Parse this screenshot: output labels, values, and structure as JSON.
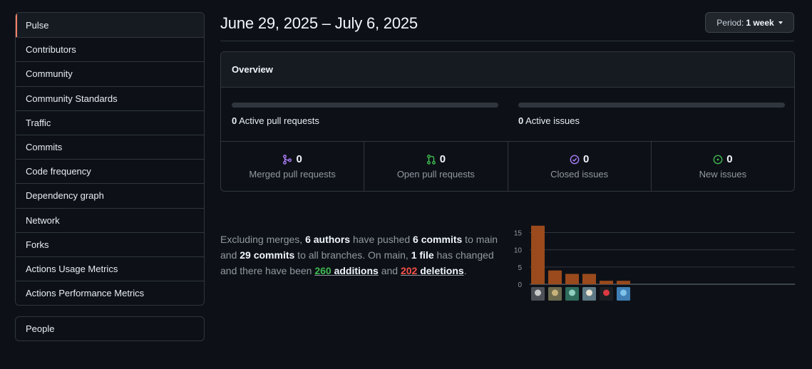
{
  "sidebar": {
    "items": [
      {
        "label": "Pulse"
      },
      {
        "label": "Contributors"
      },
      {
        "label": "Community"
      },
      {
        "label": "Community Standards"
      },
      {
        "label": "Traffic"
      },
      {
        "label": "Commits"
      },
      {
        "label": "Code frequency"
      },
      {
        "label": "Dependency graph"
      },
      {
        "label": "Network"
      },
      {
        "label": "Forks"
      },
      {
        "label": "Actions Usage Metrics"
      },
      {
        "label": "Actions Performance Metrics"
      }
    ],
    "people_label": "People"
  },
  "header": {
    "title": "June 29, 2025 – July 6, 2025",
    "period_prefix": "Period:",
    "period_value": "1 week"
  },
  "overview": {
    "title": "Overview",
    "active_prs_count": "0",
    "active_prs_label": "Active pull requests",
    "active_issues_count": "0",
    "active_issues_label": "Active issues",
    "stats": [
      {
        "icon": "git-merge-icon",
        "count": "0",
        "label": "Merged pull requests",
        "color": "#ab7df8"
      },
      {
        "icon": "git-pull-request-icon",
        "count": "0",
        "label": "Open pull requests",
        "color": "#3fb950"
      },
      {
        "icon": "issue-closed-icon",
        "count": "0",
        "label": "Closed issues",
        "color": "#ab7df8"
      },
      {
        "icon": "issue-opened-icon",
        "count": "0",
        "label": "New issues",
        "color": "#3fb950"
      }
    ]
  },
  "summary": {
    "t1": "Excluding merges, ",
    "authors": "6 authors",
    "t2": " have pushed ",
    "commits_main": "6 commits",
    "t3": " to main and ",
    "commits_all": "29 commits",
    "t4": " to all branches. On main, ",
    "files": "1 file",
    "t5": " has changed and there have been ",
    "additions_num": "260",
    "additions_word": "additions",
    "t6": " and ",
    "deletions_num": "202",
    "deletions_word": "deletions",
    "t7": "."
  },
  "colors": {
    "bar": "#9a4a1d",
    "accent_selected": "#f78166",
    "green": "#3fb950",
    "red": "#f85149",
    "purple": "#ab7df8"
  },
  "chart_data": {
    "type": "bar",
    "categories": [
      "author-1",
      "author-2",
      "author-3",
      "author-4",
      "author-5",
      "author-6"
    ],
    "values": [
      17,
      4,
      3,
      3,
      1,
      1
    ],
    "yticks": [
      "0",
      "5",
      "10",
      "15"
    ],
    "ylim": [
      0,
      18
    ],
    "grid": true,
    "xlabel": "",
    "ylabel": ""
  }
}
